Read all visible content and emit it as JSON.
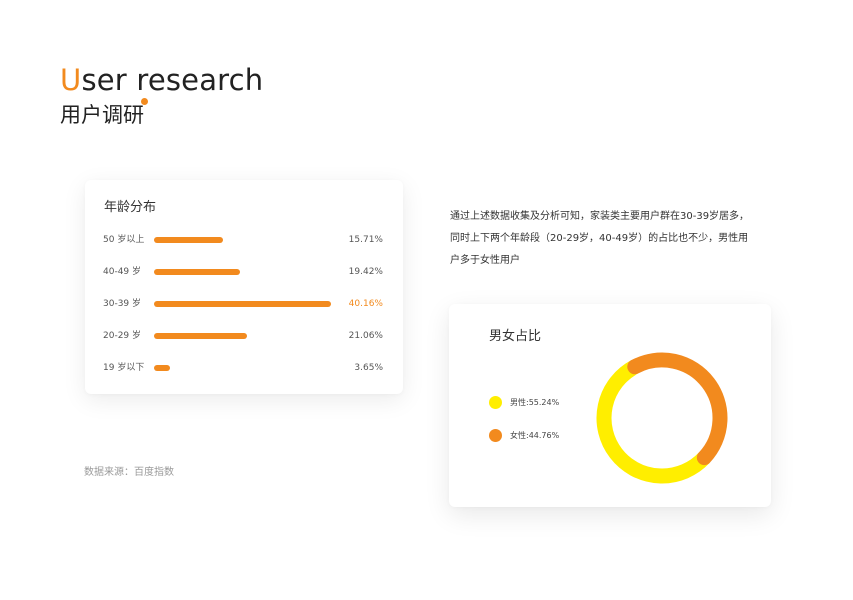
{
  "header": {
    "title_en_first": "U",
    "title_en_rest": "ser research",
    "title_zh": "用户调研"
  },
  "colors": {
    "accent": "#f28a1e",
    "male": "#ffee00",
    "female": "#f28a1e"
  },
  "age_card": {
    "title": "年龄分布",
    "source": "数据来源：百度指数"
  },
  "description": "通过上述数据收集及分析可知，家装类主要用户群在30-39岁居多，同时上下两个年龄段（20-29岁，40-49岁）的占比也不少，男性用户多于女性用户",
  "gender_card": {
    "title": "男女占比"
  },
  "chart_data": [
    {
      "type": "bar",
      "orientation": "horizontal",
      "title": "年龄分布",
      "categories": [
        "50 岁以上",
        "40-49 岁",
        "30-39 岁",
        "20-29 岁",
        "19 岁以下"
      ],
      "values": [
        15.71,
        19.42,
        40.16,
        21.06,
        3.65
      ],
      "value_labels": [
        "15.71%",
        "19.42%",
        "40.16%",
        "21.06%",
        "3.65%"
      ],
      "unit": "%",
      "highlight_index": 2
    },
    {
      "type": "pie",
      "variant": "donut",
      "title": "男女占比",
      "slices": [
        {
          "label": "男性:55.24%",
          "value": 55.24,
          "color": "#ffee00"
        },
        {
          "label": "女性:44.76%",
          "value": 44.76,
          "color": "#f28a1e"
        }
      ]
    }
  ]
}
